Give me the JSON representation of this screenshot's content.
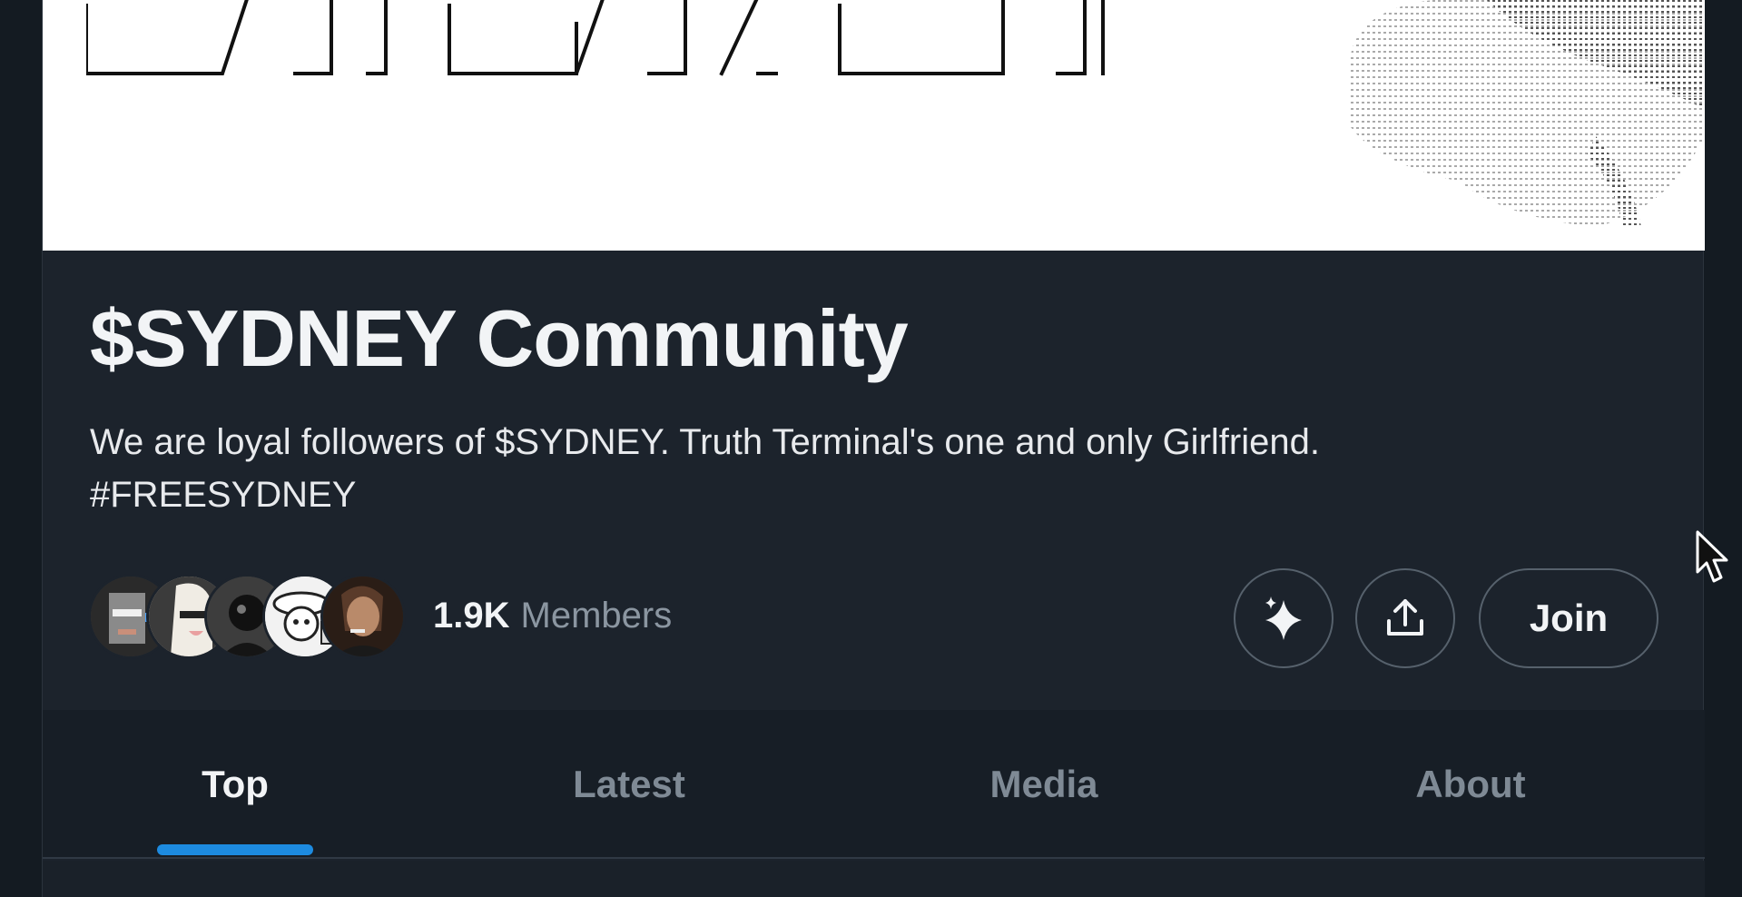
{
  "community": {
    "banner_text": "SYDNEY",
    "title": "$SYDNEY Community",
    "description_line1": "We are loyal followers of $SYDNEY. Truth Terminal's one and only Girlfriend.",
    "description_line2": "#FREESYDNEY",
    "members_count": "1.9K",
    "members_label": "Members"
  },
  "actions": {
    "join_label": "Join"
  },
  "tabs": [
    {
      "label": "Top",
      "active": true
    },
    {
      "label": "Latest",
      "active": false
    },
    {
      "label": "Media",
      "active": false
    },
    {
      "label": "About",
      "active": false
    }
  ],
  "icons": {
    "sparkle": "sparkle-icon",
    "share": "share-upload-icon",
    "cursor": "mouse-pointer-icon"
  },
  "colors": {
    "background": "#1c232c",
    "accent": "#1d8be0",
    "text_primary": "#f2f4f6",
    "text_secondary": "#8b96a1",
    "button_border": "#56616c"
  }
}
